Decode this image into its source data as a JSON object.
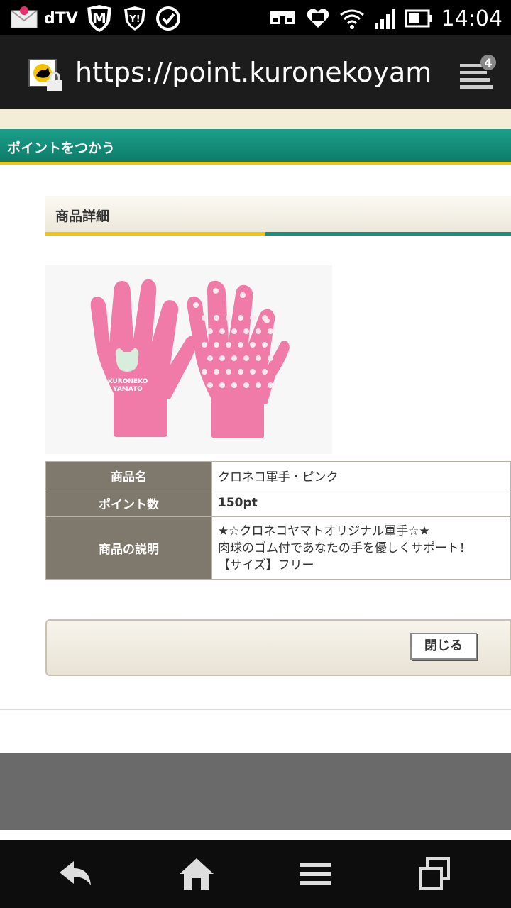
{
  "status_bar": {
    "app_label": "dTV",
    "time": "14:04"
  },
  "browser": {
    "url": "https://point.kuronekoyamato.co.jp",
    "tab_count": "4"
  },
  "page": {
    "section_title": "ポイントをつかう",
    "sub_title": "商品詳細",
    "product": {
      "name_header": "商品名",
      "name": "クロネコ軍手・ピンク",
      "points_header": "ポイント数",
      "points": "150pt",
      "desc_header": "商品の説明",
      "desc_lines": [
        "★☆クロネコヤマトオリジナル軍手☆★",
        "肉球のゴム付であなたの手を優しくサポート！",
        "【サイズ】フリー"
      ],
      "glove_print_line1": "KURONEKO",
      "glove_print_line2": "YAMATO"
    },
    "close_button": "閉じる"
  },
  "colors": {
    "section_green": "#1b9f8b",
    "accent_yellow": "#f1c40f",
    "glove_pink": "#f07aa8",
    "table_header": "#7f796d",
    "points_text": "#117a6b"
  },
  "icons": {
    "status_left": [
      "mail-icon",
      "m-shield-icon",
      "y-shield-icon",
      "check-circle-icon"
    ],
    "status_right": [
      "glasses-icon",
      "heart-icon",
      "wifi-icon",
      "signal-icon",
      "battery-icon"
    ],
    "nav": [
      "back-icon",
      "home-icon",
      "menu-icon",
      "windows-icon"
    ]
  }
}
